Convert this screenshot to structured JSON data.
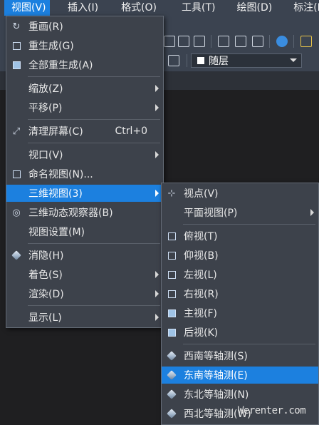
{
  "menubar": {
    "items": [
      "视图(V)",
      "插入(I)",
      "格式(O)",
      "工具(T)",
      "绘图(D)",
      "标注(N"
    ]
  },
  "toolbar": {
    "layer_value": "随层"
  },
  "view_menu": {
    "items": [
      {
        "label": "重画(R)",
        "icon": "refresh-icon"
      },
      {
        "label": "重生成(G)",
        "icon": "regen-icon"
      },
      {
        "label": "全部重生成(A)",
        "icon": "regen-all-icon"
      },
      {
        "label": "缩放(Z)",
        "submenu": true
      },
      {
        "label": "平移(P)",
        "submenu": true
      },
      {
        "label": "清理屏幕(C)",
        "icon": "clean-screen-icon",
        "shortcut": "Ctrl+0"
      },
      {
        "label": "视口(V)",
        "submenu": true
      },
      {
        "label": "命名视图(N)...",
        "icon": "named-view-icon"
      },
      {
        "label": "三维视图(3)",
        "submenu": true,
        "highlighted": true
      },
      {
        "label": "三维动态观察器(B)",
        "icon": "orbit-icon"
      },
      {
        "label": "视图设置(M)"
      },
      {
        "label": "消隐(H)",
        "icon": "hide-icon"
      },
      {
        "label": "着色(S)",
        "submenu": true
      },
      {
        "label": "渲染(D)",
        "submenu": true
      },
      {
        "label": "显示(L)",
        "submenu": true
      }
    ]
  },
  "view3d_menu": {
    "items": [
      {
        "label": "视点(V)",
        "icon": "viewpoint-icon"
      },
      {
        "label": "平面视图(P)",
        "submenu": true
      },
      {
        "label": "俯视(T)",
        "icon": "top-view-icon"
      },
      {
        "label": "仰视(B)",
        "icon": "bottom-view-icon"
      },
      {
        "label": "左视(L)",
        "icon": "left-view-icon"
      },
      {
        "label": "右视(R)",
        "icon": "right-view-icon"
      },
      {
        "label": "主视(F)",
        "icon": "front-view-icon"
      },
      {
        "label": "后视(K)",
        "icon": "back-view-icon"
      },
      {
        "label": "西南等轴测(S)",
        "icon": "sw-iso-icon"
      },
      {
        "label": "东南等轴测(E)",
        "icon": "se-iso-icon",
        "highlighted": true
      },
      {
        "label": "东北等轴测(N)",
        "icon": "ne-iso-icon"
      },
      {
        "label": "西北等轴测(W)",
        "icon": "nw-iso-icon"
      }
    ]
  },
  "watermark": "Werenter.com",
  "colors": {
    "menubar_bg": "#3b4350",
    "menu_bg": "#3d424b",
    "highlight": "#1c80df",
    "canvas_bg": "#1f1f21"
  }
}
